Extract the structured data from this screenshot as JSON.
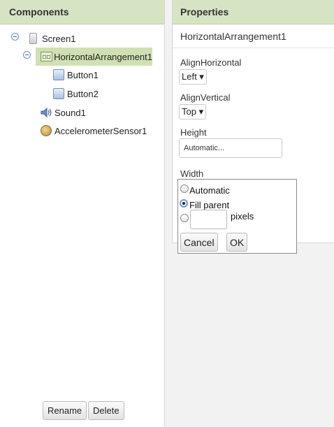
{
  "components": {
    "header": "Components",
    "tree": {
      "screen": "Screen1",
      "horizontal_arrangement": "HorizontalArrangement1",
      "button1": "Button1",
      "button2": "Button2",
      "sound": "Sound1",
      "accelerometer": "AccelerometerSensor1"
    },
    "rename_label": "Rename",
    "delete_label": "Delete"
  },
  "properties": {
    "header": "Properties",
    "component_name": "HorizontalArrangement1",
    "align_horizontal": {
      "label": "AlignHorizontal",
      "value": "Left ▾"
    },
    "align_vertical": {
      "label": "AlignVertical",
      "value": "Top ▾"
    },
    "height": {
      "label": "Height",
      "value": "Automatic..."
    },
    "width": {
      "label": "Width",
      "options": {
        "automatic": "Automatic",
        "fill_parent": "Fill parent",
        "pixels": "pixels"
      },
      "selected": "Fill parent",
      "pixels_value": "",
      "cancel_label": "Cancel",
      "ok_label": "OK"
    }
  },
  "icons": {
    "collapse": "collapse-icon",
    "screen": "screen-icon",
    "arrangement": "horizontal-arrangement-icon",
    "button": "button-icon",
    "sound": "sound-icon",
    "accelerometer": "accelerometer-icon"
  },
  "colors": {
    "header_bg": "#d7e4c4",
    "selected_bg": "#d0e0b3",
    "radio_accent": "#6f9bd3"
  }
}
